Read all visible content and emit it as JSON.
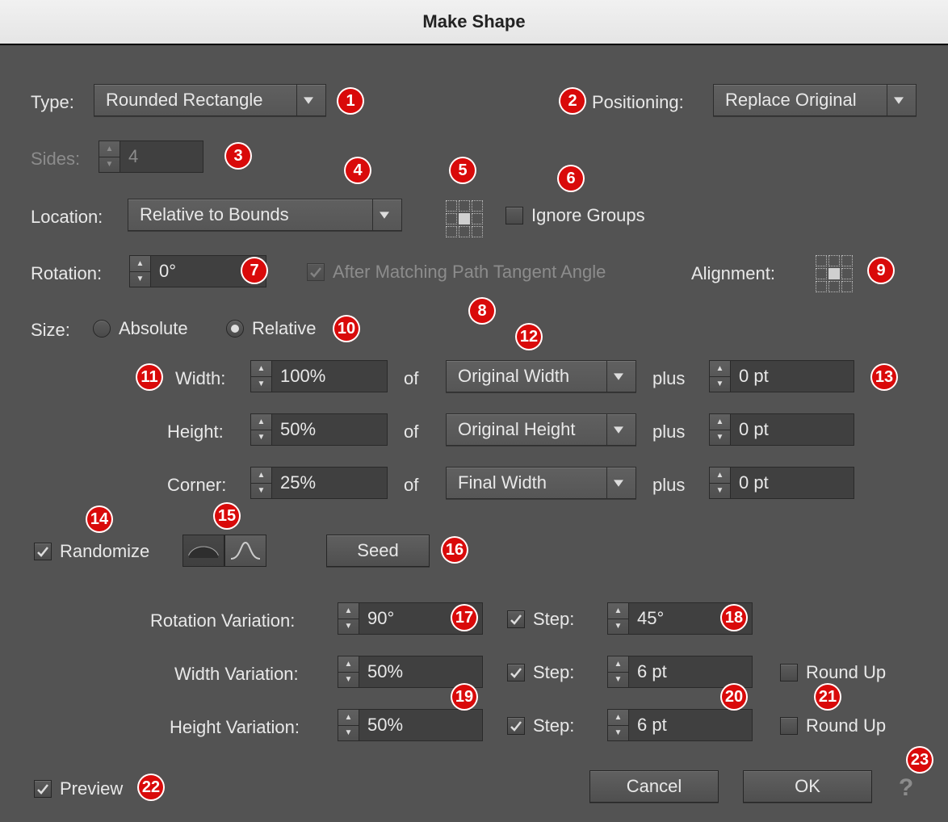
{
  "title": "Make Shape",
  "type": {
    "label": "Type:",
    "value": "Rounded Rectangle"
  },
  "positioning": {
    "label": "Positioning:",
    "value": "Replace Original"
  },
  "sides": {
    "label": "Sides:",
    "value": "4",
    "enabled": false
  },
  "location": {
    "label": "Location:",
    "value": "Relative to Bounds"
  },
  "ignoreGroups": {
    "label": "Ignore Groups",
    "checked": false
  },
  "rotation": {
    "label": "Rotation:",
    "value": "0°"
  },
  "afterMatching": {
    "label": "After Matching Path Tangent Angle",
    "checked": true,
    "enabled": false
  },
  "alignment": {
    "label": "Alignment:"
  },
  "size": {
    "label": "Size:",
    "absoluteLabel": "Absolute",
    "relativeLabel": "Relative",
    "mode": "relative"
  },
  "of": "of",
  "plus": "plus",
  "width": {
    "label": "Width:",
    "pct": "100%",
    "ref": "Original Width",
    "plus": "0 pt"
  },
  "height": {
    "label": "Height:",
    "pct": "50%",
    "ref": "Original Height",
    "plus": "0 pt"
  },
  "corner": {
    "label": "Corner:",
    "pct": "25%",
    "ref": "Final Width",
    "plus": "0 pt"
  },
  "randomize": {
    "label": "Randomize",
    "checked": true
  },
  "seed": {
    "label": "Seed"
  },
  "rotVar": {
    "label": "Rotation Variation:",
    "value": "90°",
    "stepLabel": "Step:",
    "stepChecked": true,
    "step": "45°"
  },
  "widthVar": {
    "label": "Width Variation:",
    "value": "50%",
    "stepLabel": "Step:",
    "stepChecked": true,
    "step": "6 pt",
    "roundUpLabel": "Round Up",
    "roundUp": false
  },
  "heightVar": {
    "label": "Height Variation:",
    "value": "50%",
    "stepLabel": "Step:",
    "stepChecked": true,
    "step": "6 pt",
    "roundUpLabel": "Round Up",
    "roundUp": false
  },
  "preview": {
    "label": "Preview",
    "checked": true
  },
  "buttons": {
    "cancel": "Cancel",
    "ok": "OK"
  },
  "markers": [
    "1",
    "2",
    "3",
    "4",
    "5",
    "6",
    "7",
    "8",
    "9",
    "10",
    "11",
    "12",
    "13",
    "14",
    "15",
    "16",
    "17",
    "18",
    "19",
    "20",
    "21",
    "22",
    "23"
  ]
}
